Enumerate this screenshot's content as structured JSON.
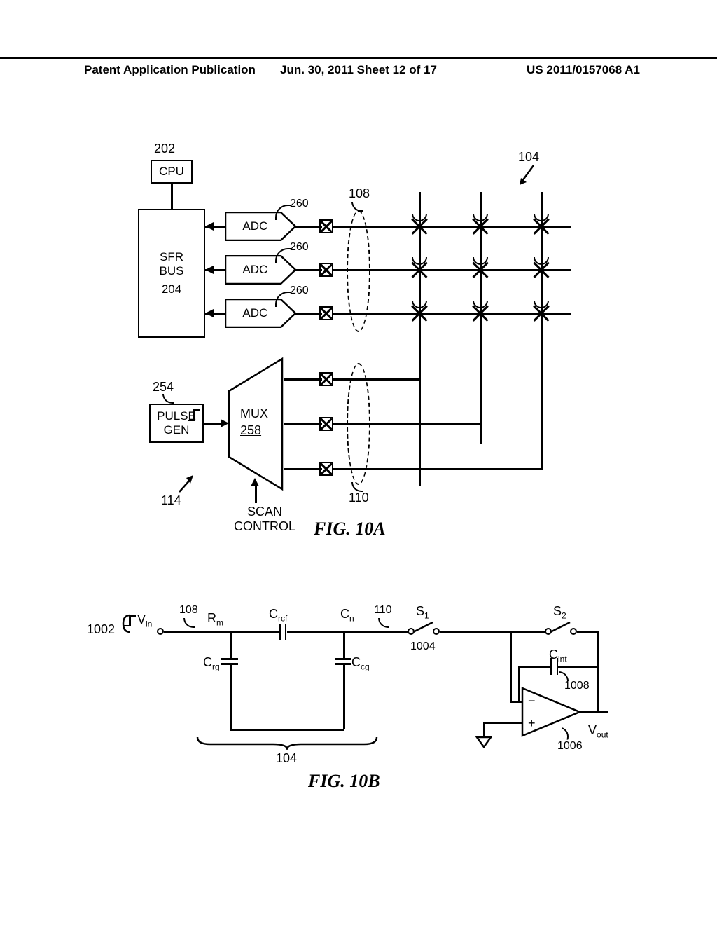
{
  "header": {
    "left": "Patent Application Publication",
    "center": "Jun. 30, 2011  Sheet 12 of 17",
    "right": "US 2011/0157068 A1"
  },
  "fig10a": {
    "caption": "FIG. 10A",
    "cpu": {
      "ref": "202",
      "label": "CPU"
    },
    "sfr_bus": {
      "label_top": "SFR",
      "label_bot": "BUS",
      "ref": "204"
    },
    "adc": {
      "label": "ADC",
      "ref": "260"
    },
    "pulse_gen": {
      "ref": "254",
      "label_top": "PULSE",
      "label_bot": "GEN"
    },
    "mux": {
      "label": "MUX",
      "ref": "258"
    },
    "scan_control": "SCAN\nCONTROL",
    "refs": {
      "row_bus": "108",
      "col_bus": "110",
      "grid": "104",
      "driver": "114"
    }
  },
  "fig10b": {
    "caption": "FIG. 10B",
    "refs": {
      "vin_src": "1002",
      "row": "108",
      "col": "110",
      "switch_node": "1004",
      "opamp": "1006",
      "cint": "1008",
      "panel": "104"
    },
    "labels": {
      "Vin": "V",
      "Vin_sub": "in",
      "Rm": "R",
      "Rm_sub": "m",
      "Crcf": "C",
      "Crcf_sub": "rcf",
      "Cn": "C",
      "Cn_sub": "n",
      "Crg": "C",
      "Crg_sub": "rg",
      "Ccg": "C",
      "Ccg_sub": "cg",
      "S1": "S",
      "S1_sub": "1",
      "S2": "S",
      "S2_sub": "2",
      "Cint": "C",
      "Cint_sub": "int",
      "Vout": "V",
      "Vout_sub": "out"
    }
  }
}
